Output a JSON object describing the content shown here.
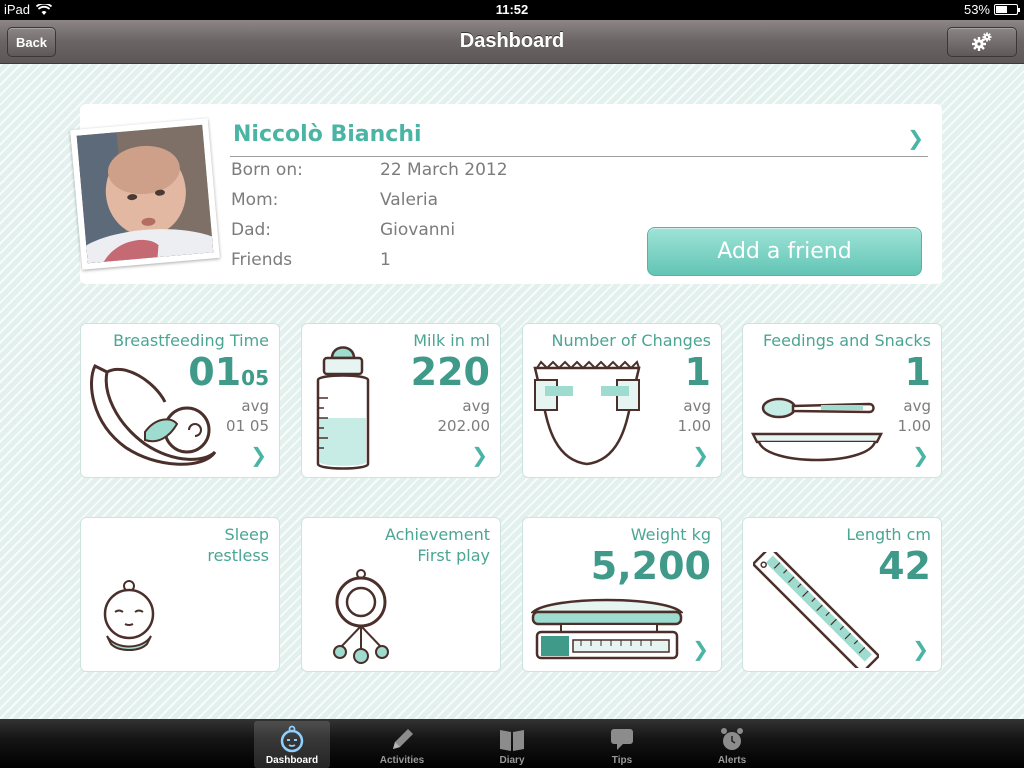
{
  "status_bar": {
    "device": "iPad",
    "time": "11:52",
    "battery": "53%",
    "battery_level": 0.53
  },
  "nav": {
    "back_label": "Back",
    "title": "Dashboard",
    "settings_icon": "gear-icon"
  },
  "profile": {
    "name": "Niccolò Bianchi",
    "rows": [
      {
        "label": "Born on:",
        "value": "22 March 2012"
      },
      {
        "label": "Mom:",
        "value": "Valeria"
      },
      {
        "label": "Dad:",
        "value": "Giovanni"
      },
      {
        "label": "Friends",
        "value": "1"
      }
    ],
    "add_friend_label": "Add a friend"
  },
  "tiles": [
    {
      "title": "Breastfeeding Time",
      "value": "01",
      "value_small": "05",
      "avg_label": "avg",
      "avg": "01 05",
      "icon": "breastfeeding-icon"
    },
    {
      "title": "Milk in ml",
      "value": "220",
      "avg_label": "avg",
      "avg": "202.00",
      "icon": "bottle-icon"
    },
    {
      "title": "Number of Changes",
      "value": "1",
      "avg_label": "avg",
      "avg": "1.00",
      "icon": "diaper-icon"
    },
    {
      "title": "Feedings and Snacks",
      "value": "1",
      "avg_label": "avg",
      "avg": "1.00",
      "icon": "spoon-bowl-icon"
    },
    {
      "title": "Sleep",
      "subtitle": "restless",
      "icon": "baby-face-icon"
    },
    {
      "title": "Achievement",
      "subtitle": "First play",
      "icon": "rattle-icon"
    },
    {
      "title": "Weight kg",
      "value": "5,200",
      "icon": "scale-icon"
    },
    {
      "title": "Length cm",
      "value": "42",
      "icon": "ruler-icon"
    }
  ],
  "tabbar": {
    "tabs": [
      {
        "label": "Dashboard",
        "icon": "baby-face-icon",
        "active": true
      },
      {
        "label": "Activities",
        "icon": "pencil-icon"
      },
      {
        "label": "Diary",
        "icon": "book-icon"
      },
      {
        "label": "Tips",
        "icon": "speech-bubble-icon"
      },
      {
        "label": "Alerts",
        "icon": "alarm-clock-icon"
      }
    ]
  },
  "colors": {
    "accent": "#4bb5a5",
    "accent_dark": "#3f9a8a",
    "nav_bg": "#6a6465",
    "background": "#e2f1ed"
  }
}
